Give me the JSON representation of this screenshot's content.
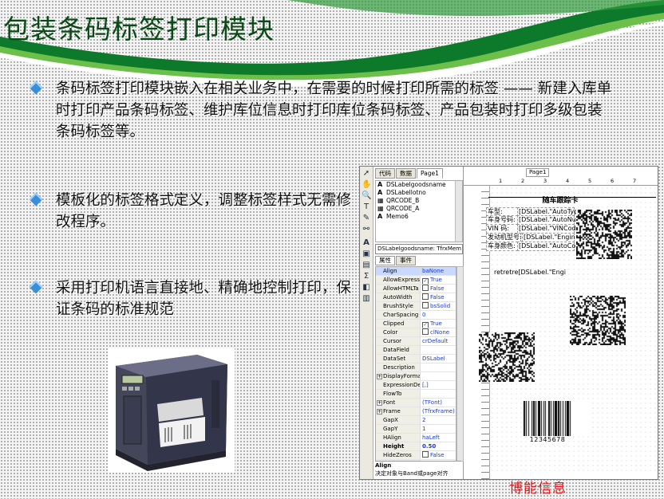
{
  "slide": {
    "title": "包装条码标签打印模块",
    "bullets": [
      "条码标签打印模块嵌入在相关业务中，在需要的时候打印所需的标签 —— 新建入库单时打印产品条码标签、维护库位信息时打印库位条码标签、产品包装时打印多级包装条码标签等。",
      "模板化的标签格式定义，调整标签样式无需修改程序。",
      "采用打印机语言直接地、精确地控制打印，保证条码的标准规范"
    ],
    "footer_brand": "博能信息"
  },
  "designer": {
    "tabs": [
      "代码",
      "数据",
      "Page1"
    ],
    "tree_items": [
      {
        "label": "DSLabelgoodsname",
        "icon": "text-icon"
      },
      {
        "label": "DSLabellotno",
        "icon": "text-icon"
      },
      {
        "label": "QRCODE_B",
        "icon": "qrcode-icon"
      },
      {
        "label": "QRCODE_A",
        "icon": "qrcode-icon"
      },
      {
        "label": "Memo6",
        "icon": "text-icon"
      }
    ],
    "object_selector": "DSLabelgoodsname: TfrxMem",
    "prop_tabs": [
      "属性",
      "事件"
    ],
    "props": [
      {
        "k": "Align",
        "v": "baNone",
        "sel": true
      },
      {
        "k": "AllowExpress",
        "v": "True",
        "cb": "✓"
      },
      {
        "k": "AllowHTMLTa",
        "v": "False",
        "cb": ""
      },
      {
        "k": "AutoWidth",
        "v": "False",
        "cb": ""
      },
      {
        "k": "BrushStyle",
        "v": "bsSolid",
        "swatch": "#ffffff"
      },
      {
        "k": "CharSpacing",
        "v": "0"
      },
      {
        "k": "Clipped",
        "v": "True",
        "cb": "✓"
      },
      {
        "k": "Color",
        "v": "clNone",
        "swatch": "#ffffff"
      },
      {
        "k": "Cursor",
        "v": "crDefault"
      },
      {
        "k": "DataField",
        "v": ""
      },
      {
        "k": "DataSet",
        "v": "DSLabel"
      },
      {
        "k": "Description",
        "v": ""
      },
      {
        "k": "DisplayForma",
        "v": "",
        "plus": true
      },
      {
        "k": "ExpressionDe",
        "v": "[,]"
      },
      {
        "k": "FlowTo",
        "v": ""
      },
      {
        "k": "Font",
        "v": "(TFont)",
        "plus": true
      },
      {
        "k": "Frame",
        "v": "(TfrxFrame)",
        "plus": true
      },
      {
        "k": "GapX",
        "v": "2"
      },
      {
        "k": "GapY",
        "v": "1"
      },
      {
        "k": "HAlign",
        "v": "haLeft"
      },
      {
        "k": "Height",
        "v": "0.50",
        "bold": true
      },
      {
        "k": "HideZeros",
        "v": "False",
        "cb": ""
      },
      {
        "k": "Highlight",
        "v": "(TfrxHighlight",
        "plus": true
      },
      {
        "k": "Hint",
        "v": ""
      }
    ],
    "help_title": "Align",
    "help_text": "决定对象与Band或page对齐",
    "page_tab": "Page1",
    "ruler": [
      "1",
      "2",
      "3",
      "4",
      "5",
      "6",
      "7"
    ],
    "card_title": "随车跟踪卡",
    "fields": [
      {
        "label": "车型:",
        "value": "[DSLabel.\"AutoTyp"
      },
      {
        "label": "车身号码:",
        "value": "[DSLabel.\"AutoNumb"
      },
      {
        "label": "VIN 码:",
        "value": "[DSLabel.\"VINCode\"]"
      },
      {
        "label": "发动机型号:",
        "value": "[DSLabel.\"Engin"
      },
      {
        "label": "车身颜色:",
        "value": "[DSLabel.\"AutoColor"
      }
    ],
    "memo_text": "retretre[DSLabel.\"Engi",
    "barcode_number": "12345678"
  }
}
